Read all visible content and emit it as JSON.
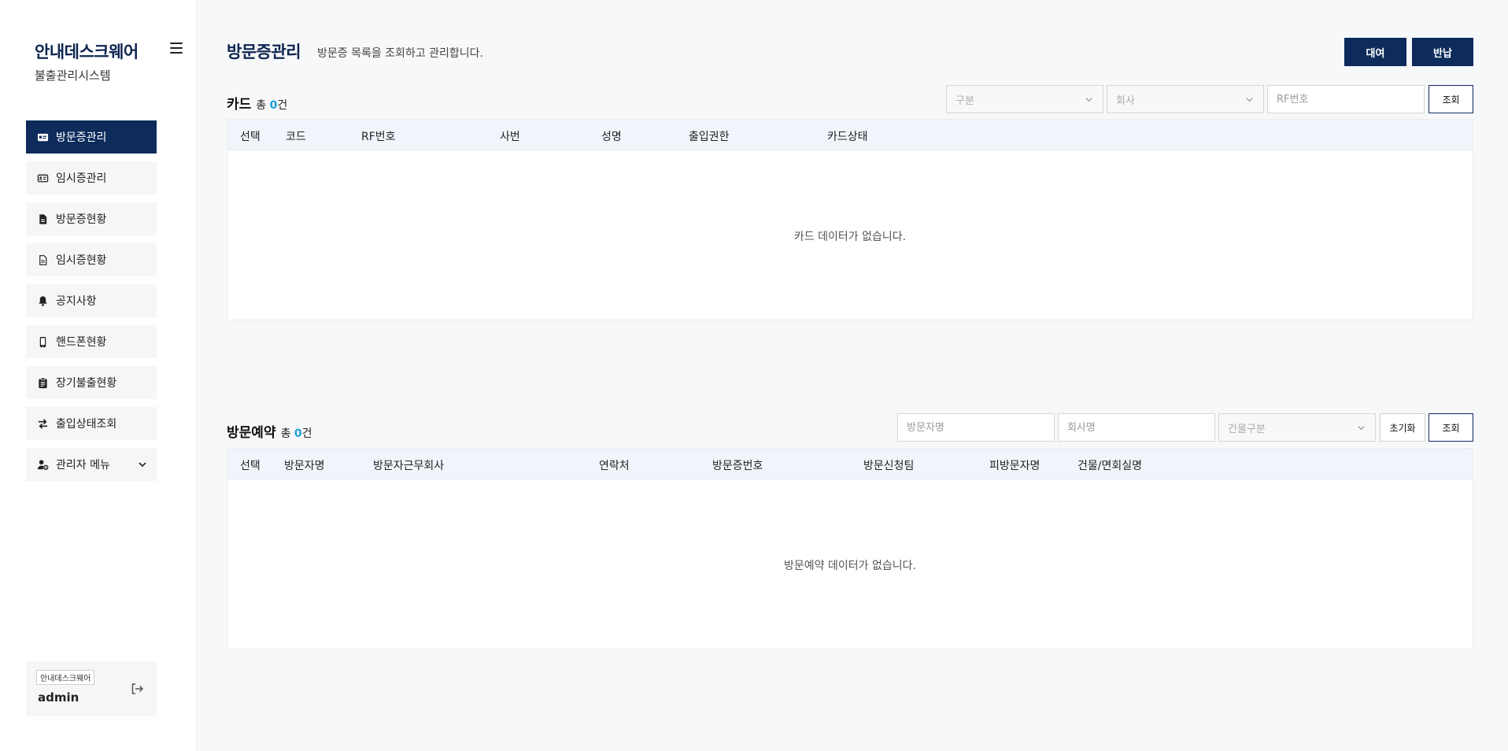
{
  "sidebar": {
    "brand_title": "안내데스크웨어",
    "brand_sub": "불출관리시스템",
    "items": [
      {
        "label": "방문증관리",
        "icon": "id-card-icon",
        "active": true
      },
      {
        "label": "임시증관리",
        "icon": "id-card-outline-icon",
        "active": false
      },
      {
        "label": "방문증현황",
        "icon": "document-icon",
        "active": false
      },
      {
        "label": "임시증현황",
        "icon": "document-outline-icon",
        "active": false
      },
      {
        "label": "공지사항",
        "icon": "bell-icon",
        "active": false
      },
      {
        "label": "핸드폰현황",
        "icon": "mobile-phone-icon",
        "active": false
      },
      {
        "label": "장기불출현황",
        "icon": "clipboard-icon",
        "active": false
      },
      {
        "label": "출입상태조회",
        "icon": "exchange-arrows-icon",
        "active": false
      },
      {
        "label": "관리자 메뉴",
        "icon": "user-gear-icon",
        "active": false
      }
    ],
    "user": {
      "badge": "안내데스크웨어",
      "name": "admin"
    }
  },
  "header": {
    "title": "방문증관리",
    "description": "방문증 목록을 조회하고 관리합니다.",
    "rent_label": "대여",
    "return_label": "반납"
  },
  "card_section": {
    "title": "카드",
    "count_prefix": "총",
    "count": "0",
    "count_suffix": "건",
    "filters": {
      "category_placeholder": "구분",
      "company_placeholder": "회사",
      "rf_placeholder": "RF번호",
      "search_label": "조회"
    },
    "columns": [
      "선택",
      "코드",
      "RF번호",
      "사번",
      "성명",
      "출입권한",
      "카드상태"
    ],
    "empty_message": "카드 데이터가 없습니다."
  },
  "reservation_section": {
    "title": "방문예약",
    "count_prefix": "총",
    "count": "0",
    "count_suffix": "건",
    "filters": {
      "visitor_placeholder": "방문자명",
      "company_placeholder": "회사명",
      "building_placeholder": "건물구분",
      "reset_label": "초기화",
      "search_label": "조회"
    },
    "columns": [
      "선택",
      "방문자명",
      "방문자근무회사",
      "연락처",
      "방문증번호",
      "방문신청팀",
      "피방문자명",
      "건물/면회실명"
    ],
    "empty_message": "방문예약 데이터가 없습니다."
  },
  "colors": {
    "primary": "#0d2c5c",
    "accent_count": "#1a9fd8",
    "header_bg": "#f1f5fb"
  }
}
